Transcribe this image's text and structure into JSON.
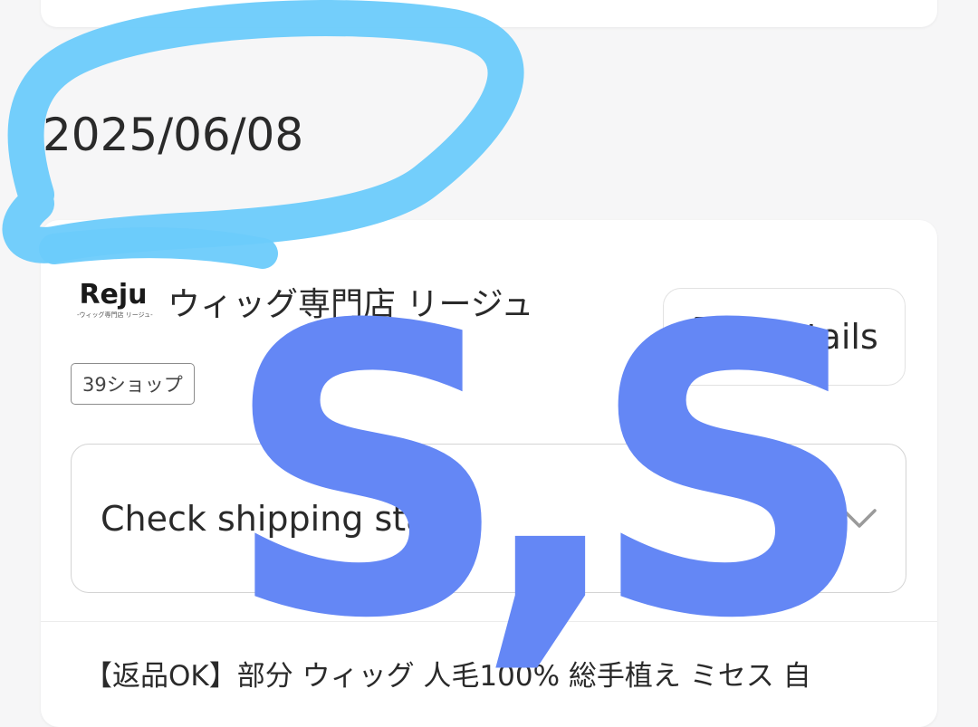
{
  "order": {
    "date": "2025/06/08"
  },
  "shop": {
    "logo_text": "Reju",
    "logo_subtext": "-ウィッグ専門店 リージュ-",
    "name": "ウィッグ専門店 リージュ",
    "badge": "39ショップ"
  },
  "actions": {
    "details_label": "Details",
    "details_icon": "document-icon",
    "shipping_label": "Check shipping status",
    "shipping_icon": "chevron-down-icon"
  },
  "product": {
    "title": "【返品OK】部分 ウィッグ 人毛100% 総手植え ミセス 自"
  },
  "annotations": {
    "overlay_text": "S,S",
    "overlay_color": "#6487f5",
    "highlight_color": "#6ccbfb"
  }
}
